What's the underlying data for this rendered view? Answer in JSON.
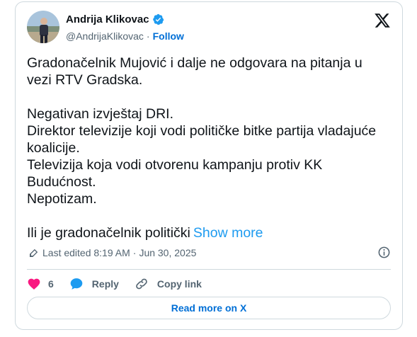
{
  "author": {
    "name": "Andrija Klikovac",
    "handle": "@AndrijaKlikovac",
    "follow_label": "Follow"
  },
  "tweet": {
    "paragraphs": [
      [
        "Gradonačelnik Mujović i dalje ne odgovara na pitanja u",
        "vezi RTV Gradska."
      ],
      [
        "Negativan izvještaj DRI.",
        "Direktor televizije koji vodi političke bitke partija vladajuće",
        "koalicije.",
        "Televizija koja vodi otvorenu kampanju protiv KK",
        "Budućnost.",
        "Nepotizam."
      ],
      [
        "Ili je gradonačelnik politički"
      ]
    ],
    "show_more_label": "Show more",
    "edited_label": "Last edited 8:19 AM",
    "date": "Jun 30, 2025"
  },
  "actions": {
    "like_count": "6",
    "reply_label": "Reply",
    "copy_link_label": "Copy link"
  },
  "read_more_label": "Read more on X",
  "colors": {
    "link": "#1d9bf0",
    "follow": "#006fd6",
    "like": "#f91880",
    "reply": "#1d9bf0",
    "verified": "#1d9bf0",
    "muted": "#536471",
    "border": "#cfd9de"
  },
  "icons": [
    "verified-badge-icon",
    "x-logo-icon",
    "pencil-icon",
    "info-icon",
    "heart-icon",
    "speech-bubble-icon",
    "link-icon"
  ]
}
